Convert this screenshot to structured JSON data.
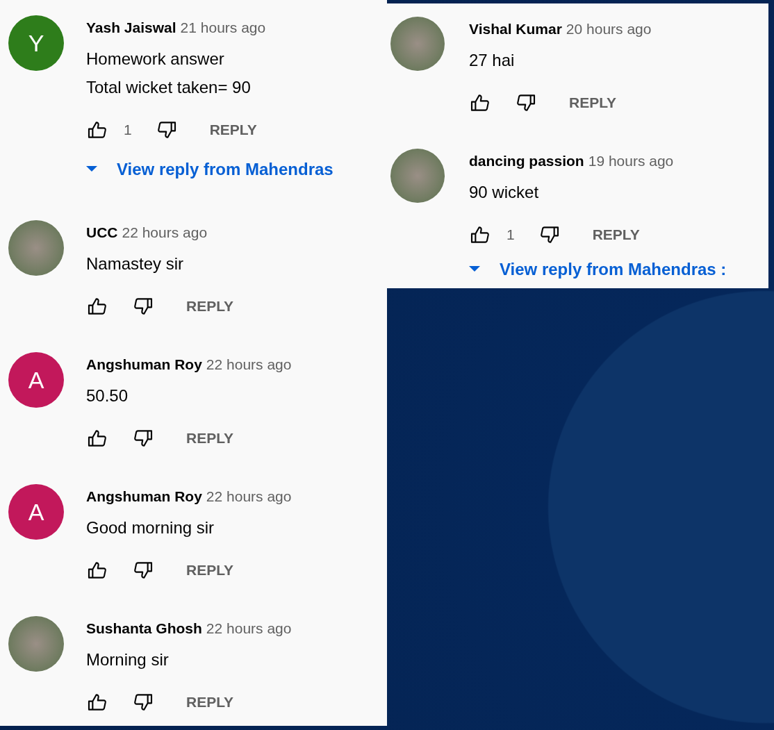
{
  "left_panel": {
    "comments": [
      {
        "avatar": {
          "kind": "letter",
          "letter": "Y",
          "color": "#2e7d1b"
        },
        "author": "Yash Jaiswal",
        "time": "21 hours ago",
        "text": [
          "Homework answer",
          "Total wicket taken= 90"
        ],
        "likes": "1",
        "reply_label": "REPLY",
        "view_replies": "View reply from Mahendras"
      },
      {
        "avatar": {
          "kind": "photo"
        },
        "author": "UCC",
        "time": "22 hours ago",
        "text": [
          "Namastey sir"
        ],
        "reply_label": "REPLY"
      },
      {
        "avatar": {
          "kind": "letter",
          "letter": "A",
          "color": "#c2185b"
        },
        "author": "Angshuman Roy",
        "time": "22 hours ago",
        "text": [
          "50.50"
        ],
        "reply_label": "REPLY"
      },
      {
        "avatar": {
          "kind": "letter",
          "letter": "A",
          "color": "#c2185b"
        },
        "author": "Angshuman Roy",
        "time": "22 hours ago",
        "text": [
          "Good morning sir"
        ],
        "reply_label": "REPLY"
      },
      {
        "avatar": {
          "kind": "photo"
        },
        "author": "Sushanta Ghosh",
        "time": "22 hours ago",
        "text": [
          "Morning sir"
        ],
        "reply_label": "REPLY"
      }
    ]
  },
  "right_panel": {
    "comments": [
      {
        "avatar": {
          "kind": "photo"
        },
        "author": "Vishal Kumar",
        "time": "20 hours ago",
        "text": [
          "27 hai"
        ],
        "reply_label": "REPLY"
      },
      {
        "avatar": {
          "kind": "photo"
        },
        "author": "dancing passion",
        "time": "19 hours ago",
        "text": [
          "90 wicket"
        ],
        "likes": "1",
        "reply_label": "REPLY",
        "view_replies": "View reply from Mahendras :"
      }
    ]
  }
}
